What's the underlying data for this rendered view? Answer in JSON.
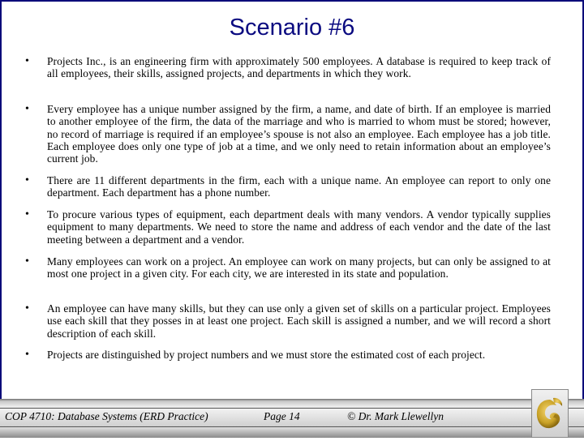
{
  "title": "Scenario #6",
  "bullets": [
    {
      "text": "Projects Inc., is an engineering firm with approximately 500 employees.  A database is required to keep track of all employees, their skills, assigned projects, and departments in which they work."
    },
    {
      "text": "Every employee has a unique number assigned by the firm, a name, and date of birth.  If an employee is married to another employee of the firm, the data of the marriage and who is married to whom must be stored; however, no record of marriage is required if an employee’s spouse is not also an employee.  Each employee has a job title.  Each employee does only one type of job at a time, and we only need to retain information about an employee’s current job."
    },
    {
      "text": "There are 11 different departments in the firm, each with a unique name.  An employee can report to only one department.  Each department has a phone number."
    },
    {
      "text": "To procure various types of equipment, each department deals with many vendors.  A vendor typically supplies equipment to many departments.  We need to store the name and address of each vendor and the date of the last meeting between a department and a vendor."
    },
    {
      "text": "Many employees can work on a project.  An employee can work on many projects, but can only be assigned to at most one project in a given city.  For each city, we are interested in its state and population."
    },
    {
      "text": "An employee can have many skills, but they can use only a given set of skills on a particular project.  Employees use each skill that they posses in at least one project.  Each skill is assigned a number, and we will record a short description of each skill."
    },
    {
      "text": "Projects are distinguished by project numbers and we must store the estimated cost of each project."
    }
  ],
  "bullet_glyph": "•",
  "footer": {
    "course": "COP 4710: Database Systems  (ERD Practice)",
    "page": "Page 14",
    "author": "© Dr. Mark Llewellyn"
  },
  "logo_icon": "ucf-pegasus-logo-icon",
  "colors": {
    "title": "#0a0a80",
    "border": "#0a0a7a",
    "logo_gold": "#c9a227"
  }
}
